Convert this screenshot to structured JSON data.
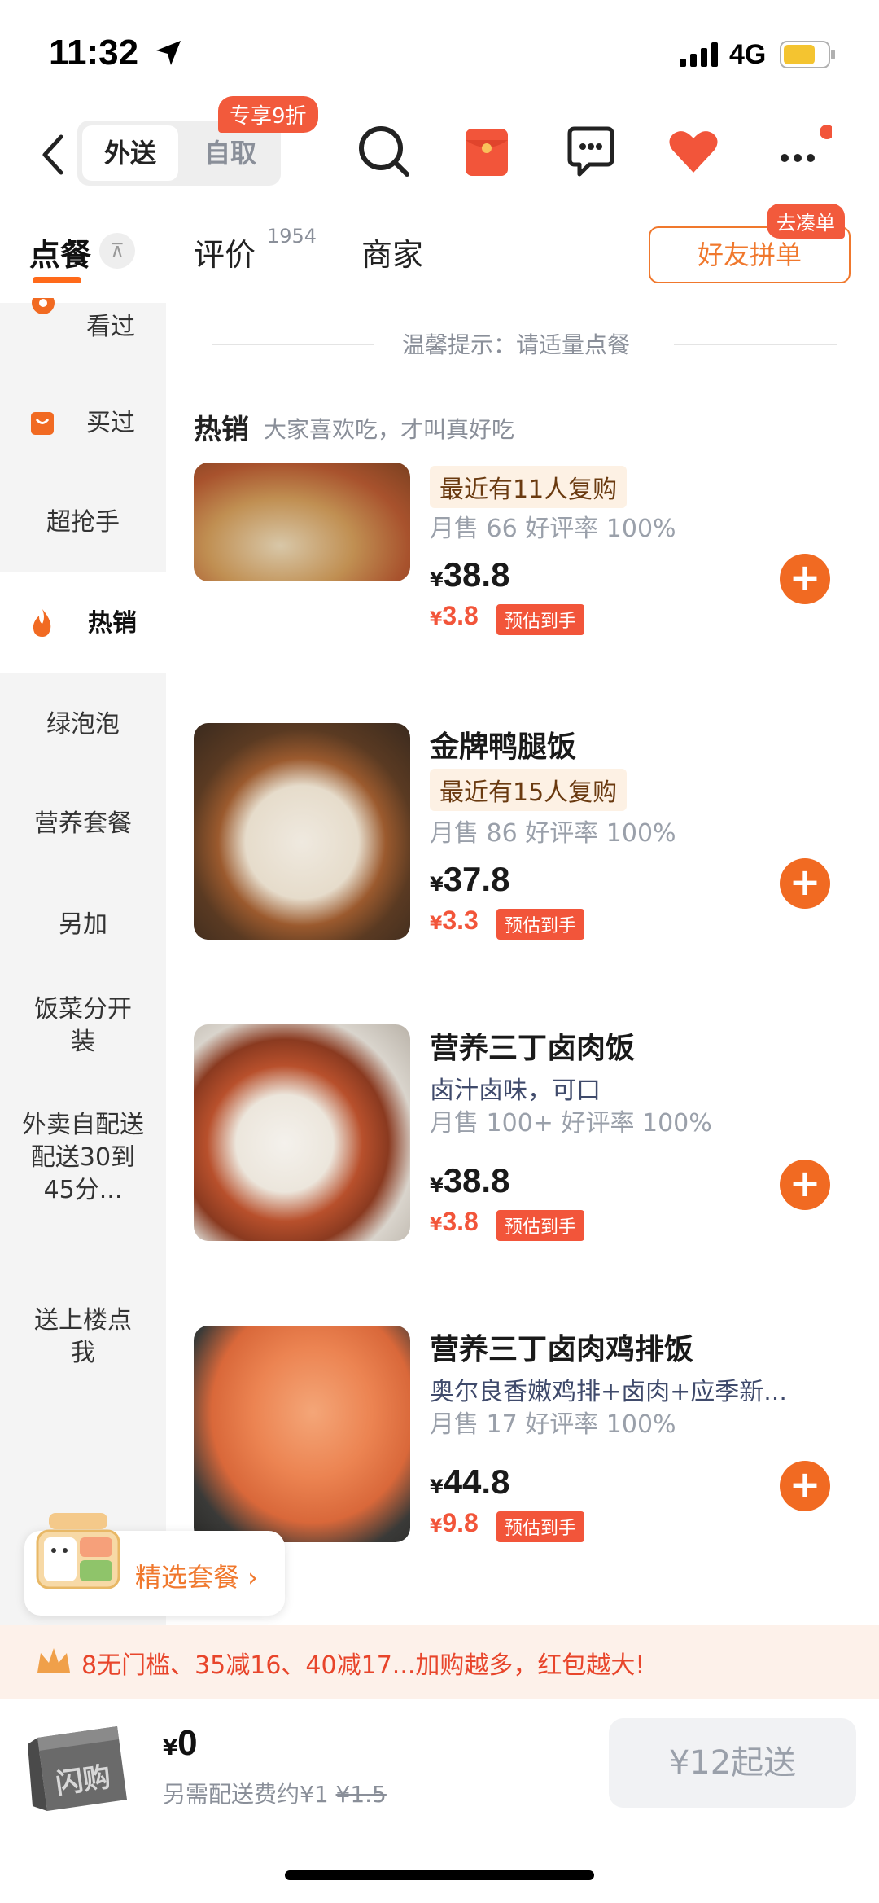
{
  "status_bar": {
    "time": "11:32",
    "network": "4G"
  },
  "header": {
    "mode_active": "外送",
    "mode_inactive": "自取",
    "discount_badge": "专享9折"
  },
  "tabs": {
    "order": "点餐",
    "reviews": "评价",
    "reviews_count": "1954",
    "merchant": "商家",
    "group_button": "好友拼单",
    "group_badge": "去凑单"
  },
  "sidebar": {
    "items": [
      "看过",
      "买过",
      "超抢手",
      "热销",
      "绿泡泡",
      "营养套餐",
      "另加",
      "饭菜分开装",
      "外卖自配送配送30到45分...",
      "送上楼点我"
    ],
    "active": "热销"
  },
  "content": {
    "tip": "温馨提示：请适量点餐",
    "section_title": "热销",
    "section_subtitle": "大家喜欢吃，才叫真好吃",
    "items": [
      {
        "name": "",
        "tag": "最近有11人复购",
        "desc": "",
        "sales": "月售 66 好评率 100%",
        "price": "38.8",
        "net_price": "3.8",
        "net_label": "预估到手"
      },
      {
        "name": "金牌鸭腿饭",
        "tag": "最近有15人复购",
        "desc": "",
        "sales": "月售 86 好评率 100%",
        "price": "37.8",
        "net_price": "3.3",
        "net_label": "预估到手"
      },
      {
        "name": "营养三丁卤肉饭",
        "tag": "",
        "desc": "卤汁卤味，可口",
        "sales": "月售 100+ 好评率 100%",
        "price": "38.8",
        "net_price": "3.8",
        "net_label": "预估到手"
      },
      {
        "name": "营养三丁卤肉鸡排饭",
        "tag": "",
        "desc": "奥尔良香嫩鸡排+卤肉+应季新...",
        "sales": "月售 17 好评率 100%",
        "price": "44.8",
        "net_price": "9.8",
        "net_label": "预估到手"
      }
    ],
    "currency": "¥"
  },
  "combo": {
    "label": "精选套餐 ›"
  },
  "promo": {
    "text": "8无门槛、35减16、40减17...加购越多，红包越大!"
  },
  "cart": {
    "currency": "¥",
    "total": "0",
    "fee_prefix": "另需配送费约¥1 ",
    "fee_original": "¥1.5",
    "checkout": "¥12起送",
    "cart_brand": "闪购"
  },
  "colors": {
    "accent": "#f16a22",
    "red": "#f2553a"
  }
}
